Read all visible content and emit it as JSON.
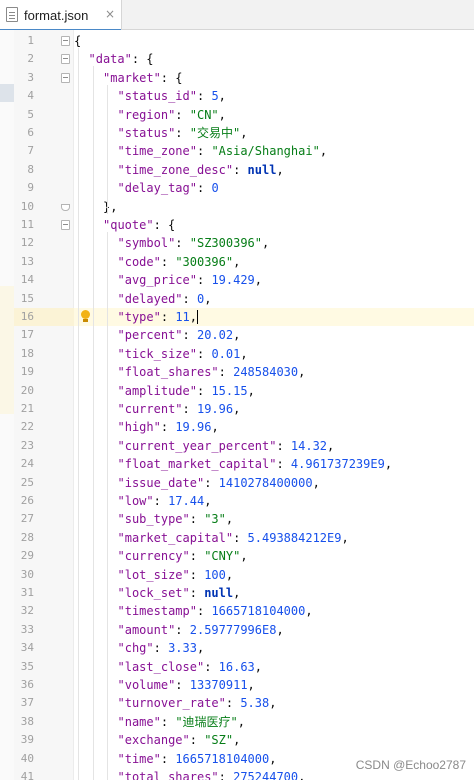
{
  "tab": {
    "title": "format.json",
    "close_glyph": "×",
    "icon": "json-file-icon"
  },
  "current_line": 16,
  "lines": [
    {
      "n": "1",
      "indent": 0,
      "parts": [
        [
          "p",
          "{"
        ]
      ],
      "fold": "start"
    },
    {
      "n": "2",
      "indent": 1,
      "parts": [
        [
          "k",
          "\"data\""
        ],
        [
          "p",
          ": {"
        ]
      ],
      "fold": "start"
    },
    {
      "n": "3",
      "indent": 2,
      "parts": [
        [
          "k",
          "\"market\""
        ],
        [
          "p",
          ": {"
        ]
      ],
      "fold": "start"
    },
    {
      "n": "4",
      "indent": 3,
      "parts": [
        [
          "k",
          "\"status_id\""
        ],
        [
          "p",
          ": "
        ],
        [
          "n",
          "5"
        ],
        [
          "p",
          ","
        ]
      ]
    },
    {
      "n": "5",
      "indent": 3,
      "parts": [
        [
          "k",
          "\"region\""
        ],
        [
          "p",
          ": "
        ],
        [
          "s",
          "\"CN\""
        ],
        [
          "p",
          ","
        ]
      ]
    },
    {
      "n": "6",
      "indent": 3,
      "parts": [
        [
          "k",
          "\"status\""
        ],
        [
          "p",
          ": "
        ],
        [
          "s",
          "\"交易中\""
        ],
        [
          "p",
          ","
        ]
      ]
    },
    {
      "n": "7",
      "indent": 3,
      "parts": [
        [
          "k",
          "\"time_zone\""
        ],
        [
          "p",
          ": "
        ],
        [
          "s",
          "\"Asia/Shanghai\""
        ],
        [
          "p",
          ","
        ]
      ]
    },
    {
      "n": "8",
      "indent": 3,
      "parts": [
        [
          "k",
          "\"time_zone_desc\""
        ],
        [
          "p",
          ": "
        ],
        [
          "l",
          "null"
        ],
        [
          "p",
          ","
        ]
      ]
    },
    {
      "n": "9",
      "indent": 3,
      "parts": [
        [
          "k",
          "\"delay_tag\""
        ],
        [
          "p",
          ": "
        ],
        [
          "n",
          "0"
        ]
      ]
    },
    {
      "n": "10",
      "indent": 2,
      "parts": [
        [
          "p",
          "},"
        ]
      ],
      "fold": "end"
    },
    {
      "n": "11",
      "indent": 2,
      "parts": [
        [
          "k",
          "\"quote\""
        ],
        [
          "p",
          ": {"
        ]
      ],
      "fold": "start"
    },
    {
      "n": "12",
      "indent": 3,
      "parts": [
        [
          "k",
          "\"symbol\""
        ],
        [
          "p",
          ": "
        ],
        [
          "s",
          "\"SZ300396\""
        ],
        [
          "p",
          ","
        ]
      ]
    },
    {
      "n": "13",
      "indent": 3,
      "parts": [
        [
          "k",
          "\"code\""
        ],
        [
          "p",
          ": "
        ],
        [
          "s",
          "\"300396\""
        ],
        [
          "p",
          ","
        ]
      ]
    },
    {
      "n": "14",
      "indent": 3,
      "parts": [
        [
          "k",
          "\"avg_price\""
        ],
        [
          "p",
          ": "
        ],
        [
          "n",
          "19.429"
        ],
        [
          "p",
          ","
        ]
      ]
    },
    {
      "n": "15",
      "indent": 3,
      "parts": [
        [
          "k",
          "\"delayed\""
        ],
        [
          "p",
          ": "
        ],
        [
          "n",
          "0"
        ],
        [
          "p",
          ","
        ]
      ]
    },
    {
      "n": "16",
      "indent": 3,
      "parts": [
        [
          "k",
          "\"type\""
        ],
        [
          "p",
          ": "
        ],
        [
          "n",
          "11"
        ],
        [
          "p",
          ","
        ]
      ],
      "bulb": true,
      "caret": true
    },
    {
      "n": "17",
      "indent": 3,
      "parts": [
        [
          "k",
          "\"percent\""
        ],
        [
          "p",
          ": "
        ],
        [
          "n",
          "20.02"
        ],
        [
          "p",
          ","
        ]
      ]
    },
    {
      "n": "18",
      "indent": 3,
      "parts": [
        [
          "k",
          "\"tick_size\""
        ],
        [
          "p",
          ": "
        ],
        [
          "n",
          "0.01"
        ],
        [
          "p",
          ","
        ]
      ]
    },
    {
      "n": "19",
      "indent": 3,
      "parts": [
        [
          "k",
          "\"float_shares\""
        ],
        [
          "p",
          ": "
        ],
        [
          "n",
          "248584030"
        ],
        [
          "p",
          ","
        ]
      ]
    },
    {
      "n": "20",
      "indent": 3,
      "parts": [
        [
          "k",
          "\"amplitude\""
        ],
        [
          "p",
          ": "
        ],
        [
          "n",
          "15.15"
        ],
        [
          "p",
          ","
        ]
      ]
    },
    {
      "n": "21",
      "indent": 3,
      "parts": [
        [
          "k",
          "\"current\""
        ],
        [
          "p",
          ": "
        ],
        [
          "n",
          "19.96"
        ],
        [
          "p",
          ","
        ]
      ]
    },
    {
      "n": "22",
      "indent": 3,
      "parts": [
        [
          "k",
          "\"high\""
        ],
        [
          "p",
          ": "
        ],
        [
          "n",
          "19.96"
        ],
        [
          "p",
          ","
        ]
      ]
    },
    {
      "n": "23",
      "indent": 3,
      "parts": [
        [
          "k",
          "\"current_year_percent\""
        ],
        [
          "p",
          ": "
        ],
        [
          "n",
          "14.32"
        ],
        [
          "p",
          ","
        ]
      ]
    },
    {
      "n": "24",
      "indent": 3,
      "parts": [
        [
          "k",
          "\"float_market_capital\""
        ],
        [
          "p",
          ": "
        ],
        [
          "n",
          "4.961737239E9"
        ],
        [
          "p",
          ","
        ]
      ]
    },
    {
      "n": "25",
      "indent": 3,
      "parts": [
        [
          "k",
          "\"issue_date\""
        ],
        [
          "p",
          ": "
        ],
        [
          "n",
          "1410278400000"
        ],
        [
          "p",
          ","
        ]
      ]
    },
    {
      "n": "26",
      "indent": 3,
      "parts": [
        [
          "k",
          "\"low\""
        ],
        [
          "p",
          ": "
        ],
        [
          "n",
          "17.44"
        ],
        [
          "p",
          ","
        ]
      ]
    },
    {
      "n": "27",
      "indent": 3,
      "parts": [
        [
          "k",
          "\"sub_type\""
        ],
        [
          "p",
          ": "
        ],
        [
          "s",
          "\"3\""
        ],
        [
          "p",
          ","
        ]
      ]
    },
    {
      "n": "28",
      "indent": 3,
      "parts": [
        [
          "k",
          "\"market_capital\""
        ],
        [
          "p",
          ": "
        ],
        [
          "n",
          "5.493884212E9"
        ],
        [
          "p",
          ","
        ]
      ]
    },
    {
      "n": "29",
      "indent": 3,
      "parts": [
        [
          "k",
          "\"currency\""
        ],
        [
          "p",
          ": "
        ],
        [
          "s",
          "\"CNY\""
        ],
        [
          "p",
          ","
        ]
      ]
    },
    {
      "n": "30",
      "indent": 3,
      "parts": [
        [
          "k",
          "\"lot_size\""
        ],
        [
          "p",
          ": "
        ],
        [
          "n",
          "100"
        ],
        [
          "p",
          ","
        ]
      ]
    },
    {
      "n": "31",
      "indent": 3,
      "parts": [
        [
          "k",
          "\"lock_set\""
        ],
        [
          "p",
          ": "
        ],
        [
          "l",
          "null"
        ],
        [
          "p",
          ","
        ]
      ]
    },
    {
      "n": "32",
      "indent": 3,
      "parts": [
        [
          "k",
          "\"timestamp\""
        ],
        [
          "p",
          ": "
        ],
        [
          "n",
          "1665718104000"
        ],
        [
          "p",
          ","
        ]
      ]
    },
    {
      "n": "33",
      "indent": 3,
      "parts": [
        [
          "k",
          "\"amount\""
        ],
        [
          "p",
          ": "
        ],
        [
          "n",
          "2.59777996E8"
        ],
        [
          "p",
          ","
        ]
      ]
    },
    {
      "n": "34",
      "indent": 3,
      "parts": [
        [
          "k",
          "\"chg\""
        ],
        [
          "p",
          ": "
        ],
        [
          "n",
          "3.33"
        ],
        [
          "p",
          ","
        ]
      ]
    },
    {
      "n": "35",
      "indent": 3,
      "parts": [
        [
          "k",
          "\"last_close\""
        ],
        [
          "p",
          ": "
        ],
        [
          "n",
          "16.63"
        ],
        [
          "p",
          ","
        ]
      ]
    },
    {
      "n": "36",
      "indent": 3,
      "parts": [
        [
          "k",
          "\"volume\""
        ],
        [
          "p",
          ": "
        ],
        [
          "n",
          "13370911"
        ],
        [
          "p",
          ","
        ]
      ]
    },
    {
      "n": "37",
      "indent": 3,
      "parts": [
        [
          "k",
          "\"turnover_rate\""
        ],
        [
          "p",
          ": "
        ],
        [
          "n",
          "5.38"
        ],
        [
          "p",
          ","
        ]
      ]
    },
    {
      "n": "38",
      "indent": 3,
      "parts": [
        [
          "k",
          "\"name\""
        ],
        [
          "p",
          ": "
        ],
        [
          "s",
          "\"迪瑞医疗\""
        ],
        [
          "p",
          ","
        ]
      ]
    },
    {
      "n": "39",
      "indent": 3,
      "parts": [
        [
          "k",
          "\"exchange\""
        ],
        [
          "p",
          ": "
        ],
        [
          "s",
          "\"SZ\""
        ],
        [
          "p",
          ","
        ]
      ]
    },
    {
      "n": "40",
      "indent": 3,
      "parts": [
        [
          "k",
          "\"time\""
        ],
        [
          "p",
          ": "
        ],
        [
          "n",
          "1665718104000"
        ],
        [
          "p",
          ","
        ]
      ]
    },
    {
      "n": "41",
      "indent": 3,
      "parts": [
        [
          "k",
          "\"total_shares\""
        ],
        [
          "p",
          ": "
        ],
        [
          "n",
          "275244700"
        ],
        [
          "p",
          ","
        ]
      ]
    }
  ],
  "watermark": "CSDN @Echoo2787",
  "colors": {
    "key": "#871094",
    "string": "#067d17",
    "number": "#1750eb",
    "literal": "#0033b3",
    "caret_line": "#fffae3"
  }
}
